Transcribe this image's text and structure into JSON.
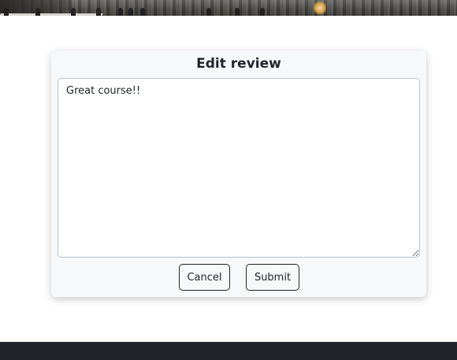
{
  "dialog": {
    "title": "Edit review",
    "review_text": "Great course!!",
    "cancel_label": "Cancel",
    "submit_label": "Submit"
  },
  "colors": {
    "card_background": "#f7f8fa",
    "footer_background": "#212529",
    "button_border": "#212529",
    "textarea_border": "#b9c3ce"
  }
}
